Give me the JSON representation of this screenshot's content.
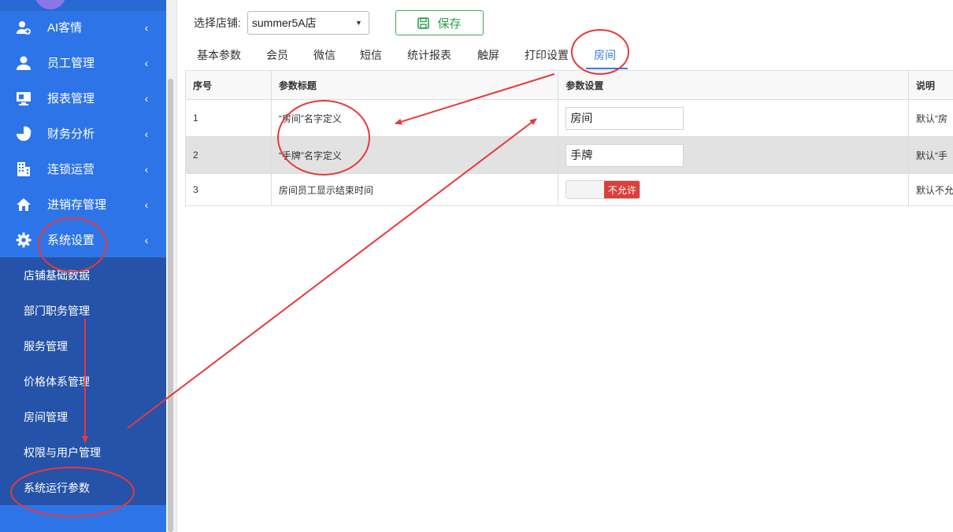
{
  "sidebar": {
    "menu": [
      {
        "label": "AI客情",
        "icon": "user-plus-icon"
      },
      {
        "label": "员工管理",
        "icon": "user-icon"
      },
      {
        "label": "报表管理",
        "icon": "monitor-icon"
      },
      {
        "label": "财务分析",
        "icon": "pie-chart-icon"
      },
      {
        "label": "连锁运营",
        "icon": "building-icon"
      },
      {
        "label": "进销存管理",
        "icon": "home-icon"
      },
      {
        "label": "系统设置",
        "icon": "gear-icon"
      }
    ],
    "submenu": [
      {
        "label": "店铺基础数据"
      },
      {
        "label": "部门职务管理"
      },
      {
        "label": "服务管理"
      },
      {
        "label": "价格体系管理"
      },
      {
        "label": "房间管理"
      },
      {
        "label": "权限与用户管理"
      },
      {
        "label": "系统运行参数"
      }
    ]
  },
  "toolbar": {
    "store_label": "选择店铺:",
    "store_value": "summer5A店",
    "save_label": "保存"
  },
  "tabs": [
    {
      "label": "基本参数"
    },
    {
      "label": "会员"
    },
    {
      "label": "微信"
    },
    {
      "label": "短信"
    },
    {
      "label": "统计报表"
    },
    {
      "label": "触屏"
    },
    {
      "label": "打印设置"
    },
    {
      "label": "房间",
      "active": true
    }
  ],
  "table": {
    "headers": [
      "序号",
      "参数标题",
      "参数设置",
      "说明"
    ],
    "rows": [
      {
        "no": "1",
        "title": "“房间”名字定义",
        "value": "房间",
        "desc": "默认“房"
      },
      {
        "no": "2",
        "title": "“手牌”名字定义",
        "value": "手牌",
        "desc": "默认“手"
      },
      {
        "no": "3",
        "title": "房间员工显示结束时间",
        "toggle_label": "不允许",
        "desc": "默认不允"
      }
    ]
  },
  "colors": {
    "sidebar_bg": "#2d74e8",
    "submenu_bg": "#2553a9",
    "accent": "#2f7be4",
    "save_green": "#2f9e4d",
    "toggle_red": "#d9403d",
    "annotation_red": "#e8383a"
  }
}
